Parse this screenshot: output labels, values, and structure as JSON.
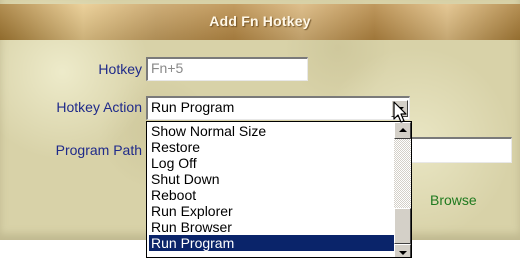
{
  "dialog": {
    "title": "Add Fn Hotkey"
  },
  "hotkey": {
    "label": "Hotkey",
    "value": "Fn+5"
  },
  "action": {
    "label": "Hotkey Action",
    "selected": "Run Program",
    "options": [
      "Show Normal Size",
      "Restore",
      "Log Off",
      "Shut Down",
      "Reboot",
      "Run Explorer",
      "Run Browser",
      "Run Program"
    ]
  },
  "program_path": {
    "label": "Program Path",
    "value": ""
  },
  "browse": {
    "label": "Browse"
  },
  "colors": {
    "label_text": "#1f2a8a",
    "browse_text": "#1f7a1f",
    "selection": "#0a246a",
    "title_bar": "#b88a45"
  },
  "icons": {
    "dropdown": "chevron-down-icon",
    "cursor": "mouse-pointer-icon",
    "scroll_up": "scroll-up-arrow-icon",
    "scroll_down": "scroll-down-arrow-icon"
  }
}
